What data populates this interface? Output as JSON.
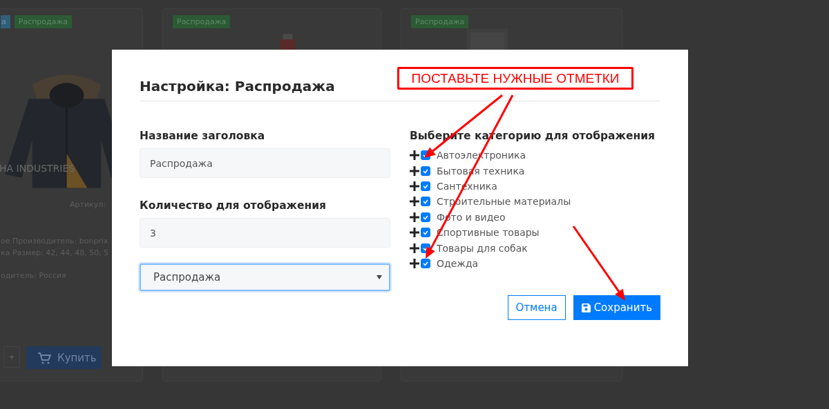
{
  "background": {
    "cards": [
      {
        "badges": [
          {
            "text": "а",
            "color": "#2f5f7a"
          },
          {
            "text": "Распродажа",
            "color": "#2c5a34"
          }
        ],
        "title": "HA INDUSTRIES",
        "lines": [
          "Артикул:",
          "ое Производитель: bonprix",
          "ка Размер: 42, 44, 48, 50, 5",
          "одитель: Россия"
        ],
        "stepper": "+",
        "buy": "Купить"
      },
      {
        "badges": [
          {
            "text": "Распродажа",
            "color": "#2c5a34"
          }
        ]
      },
      {
        "badges": [
          {
            "text": "Распродажа",
            "color": "#2c5a34"
          }
        ]
      }
    ]
  },
  "modal": {
    "title": "Настройка: Распродажа",
    "fields": [
      {
        "label": "Название заголовка",
        "value": "Распродажа"
      },
      {
        "label": "Количество для отображения",
        "value": "3"
      }
    ],
    "select": {
      "value": "Распродажа",
      "focused": true
    },
    "categories": {
      "heading": "Выберите категорию для отображения",
      "items": [
        {
          "label": "Автоэлектроника",
          "checked": true,
          "expanded": false
        },
        {
          "label": "Бытовая техника",
          "checked": true,
          "expanded": false
        },
        {
          "label": "Сантехника",
          "checked": true,
          "expanded": false
        },
        {
          "label": "Строительные материалы",
          "checked": true,
          "expanded": false
        },
        {
          "label": "Фото и видео",
          "checked": true,
          "expanded": false
        },
        {
          "label": "Спортивные товары",
          "checked": true,
          "expanded": false
        },
        {
          "label": "Товары для собак",
          "checked": true,
          "expanded": false
        },
        {
          "label": "Одежда",
          "checked": true,
          "expanded": false
        }
      ]
    },
    "buttons": [
      {
        "label": "Отмена",
        "kind": "secondary"
      },
      {
        "label": "Сохранить",
        "kind": "primary"
      }
    ]
  },
  "annotation": {
    "text": "ПОСТАВЬТЕ НУЖНЫЕ ОТМЕТКИ"
  }
}
